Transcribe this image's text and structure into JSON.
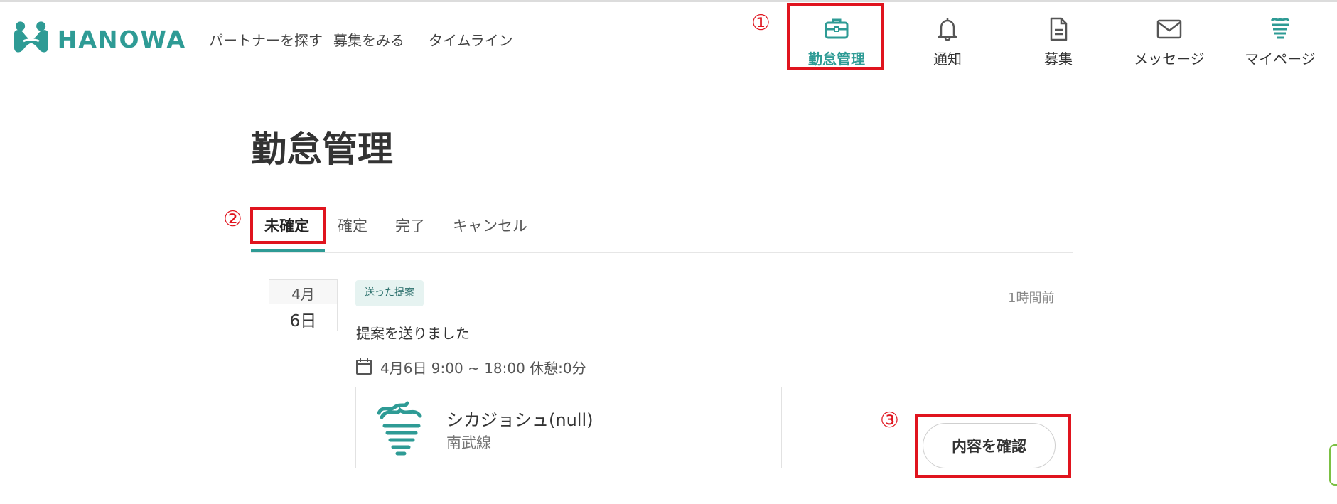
{
  "header": {
    "logo_text": "HANOWA",
    "nav_links": [
      {
        "label": "パートナーを探す"
      },
      {
        "label": "募集をみる"
      },
      {
        "label": "タイムライン"
      }
    ],
    "nav_buttons": [
      {
        "label": "勤怠管理",
        "icon": "briefcase-icon",
        "active": true
      },
      {
        "label": "通知",
        "icon": "bell-icon",
        "active": false
      },
      {
        "label": "募集",
        "icon": "document-icon",
        "active": false
      },
      {
        "label": "メッセージ",
        "icon": "mail-icon",
        "active": false
      },
      {
        "label": "マイページ",
        "icon": "tooth-avatar-icon",
        "active": false
      }
    ]
  },
  "annotations": [
    "①",
    "②",
    "③"
  ],
  "page": {
    "title": "勤怠管理",
    "tabs": [
      {
        "label": "未確定",
        "active": true
      },
      {
        "label": "確定",
        "active": false
      },
      {
        "label": "完了",
        "active": false
      },
      {
        "label": "キャンセル",
        "active": false
      }
    ]
  },
  "card": {
    "month": "4月",
    "day": "6日",
    "badge": "送った提案",
    "time_ago": "1時間前",
    "message": "提案を送りました",
    "schedule": "4月6日 9:00 ~ 18:00 休憩:0分",
    "partner_name": "シカジョシュ(null)",
    "partner_line": "南武線",
    "confirm_label": "内容を確認"
  },
  "colors": {
    "accent": "#2e9b95",
    "annotation_red": "#e0141e",
    "badge_bg": "#e6f3f1"
  }
}
